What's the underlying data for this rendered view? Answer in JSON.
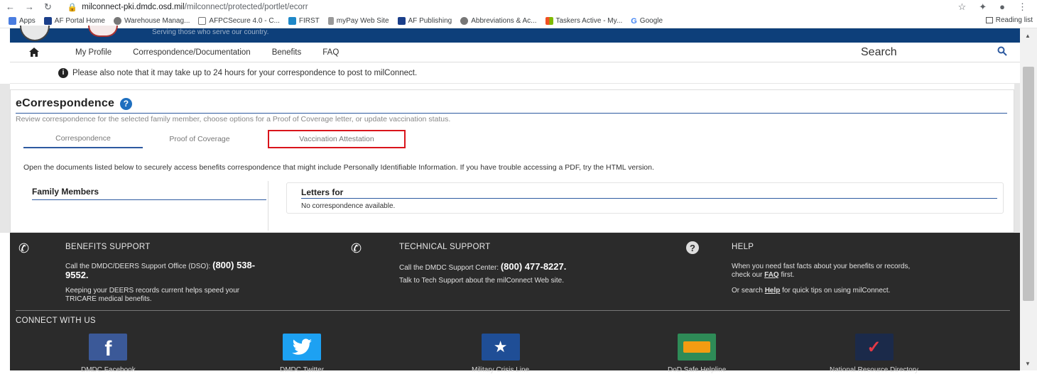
{
  "browser": {
    "url_host": "milconnect-pki.dmdc.osd.mil",
    "url_path": "/milconnect/protected/portlet/ecorr",
    "bookmarks": [
      "Apps",
      "AF Portal Home",
      "Warehouse Manag...",
      "AFPCSecure 4.0 - C...",
      "FIRST",
      "myPay Web Site",
      "AF Publishing",
      "Abbreviations & Ac...",
      "Taskers Active - My...",
      "Google"
    ],
    "reading_list": "Reading list"
  },
  "banner": {
    "tagline": "Serving those who serve our country."
  },
  "nav": {
    "items": [
      "My Profile",
      "Correspondence/Documentation",
      "Benefits",
      "FAQ"
    ],
    "search_label": "Search"
  },
  "notice": "Please also note that it may take up to 24 hours for your correspondence to post to milConnect.",
  "ecorr": {
    "title": "eCorrespondence",
    "description": "Review correspondence for the selected family member, choose options for a Proof of Coverage letter, or update vaccination status.",
    "tabs": [
      "Correspondence",
      "Proof of Coverage",
      "Vaccination Attestation"
    ],
    "intro": "Open the documents listed below to securely access benefits correspondence that might include Personally Identifiable Information. If you have trouble accessing a PDF, try the HTML version.",
    "family_members": "Family Members",
    "letters_for": "Letters for",
    "no_correspondence": "No correspondence available."
  },
  "footer": {
    "benefits": {
      "heading": "BENEFITS SUPPORT",
      "line1": "Call the DMDC/DEERS Support Office (DSO):",
      "phone_a": "(800) 538-",
      "phone_b": "9552",
      "line2": "Keeping your DEERS records current helps speed your",
      "line3": "TRICARE medical benefits."
    },
    "technical": {
      "heading": "TECHNICAL SUPPORT",
      "line1": "Call the DMDC Support Center:",
      "phone": "(800) 477-8227",
      "line2": "Talk to Tech Support about the milConnect Web site."
    },
    "help": {
      "heading": "HELP",
      "line1": "When you need fast facts about your benefits or records,",
      "line2a": "check our",
      "faq": "FAQ",
      "line2b": "first.",
      "line3a": "Or search",
      "help_link": "Help",
      "line3b": "for quick tips on using milConnect."
    },
    "connect": "CONNECT WITH US",
    "social": [
      {
        "label": "DMDC Facebook",
        "color": "#3b5998"
      },
      {
        "label": "DMDC Twitter",
        "color": "#1da1f2"
      },
      {
        "label": "Military Crisis Line",
        "color": "#1f4e96"
      },
      {
        "label": "DoD Safe Helpline",
        "color": "#2e8b57"
      },
      {
        "label": "National Resource Directory",
        "color": "#1b2a4a"
      }
    ]
  }
}
